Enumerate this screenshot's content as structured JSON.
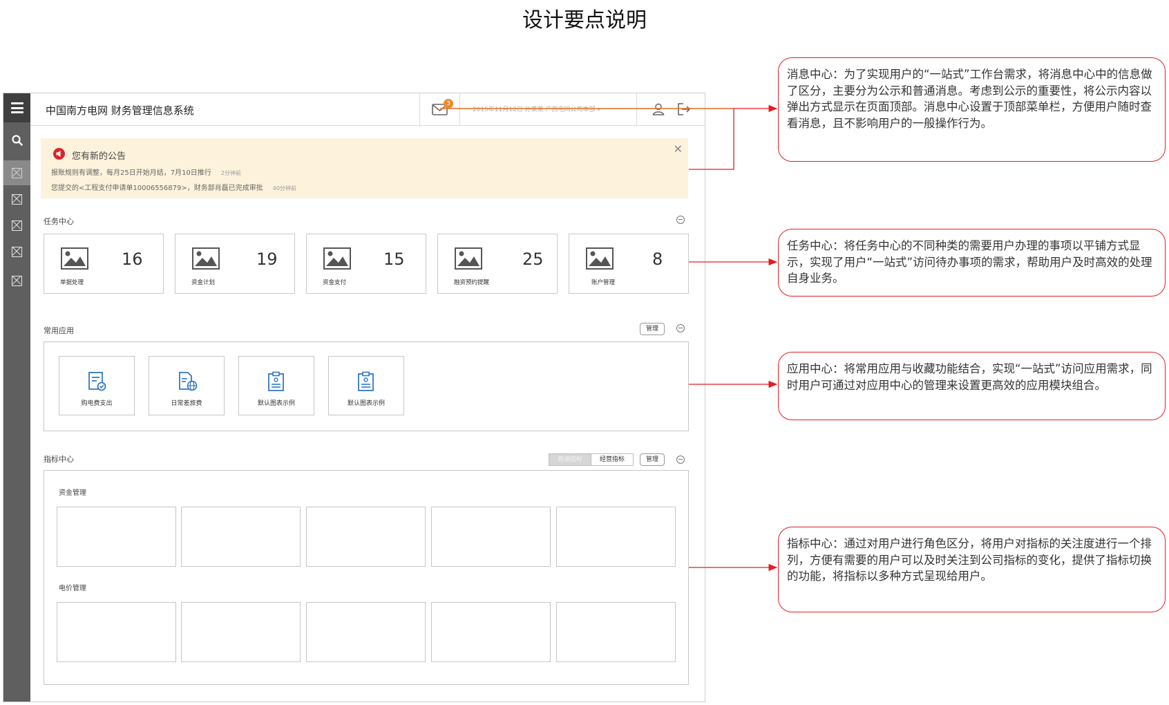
{
  "page": {
    "title": "设计要点说明"
  },
  "app": {
    "title": "中国南方电网 财务管理信息系统",
    "mail_badge": "3",
    "user_info": "2015年11月12日 孙某某 广西电网公司本部 ▾",
    "icons": [
      "menu-icon",
      "search-icon",
      "mail-icon",
      "user-icon",
      "logout-icon"
    ]
  },
  "notice": {
    "title": "您有新的公告",
    "items": [
      {
        "text": "报账规则有调整，每月25日开始月结，7月10日推行",
        "time": "2分钟前"
      },
      {
        "text": "您提交的<工程支付申请单10006556879>，财务部肖磊已完成审批",
        "time": "40分钟前"
      }
    ]
  },
  "task_center": {
    "label": "任务中心",
    "cards": [
      {
        "label": "单据处理",
        "count": "16"
      },
      {
        "label": "资金计划",
        "count": "19"
      },
      {
        "label": "资金支付",
        "count": "15"
      },
      {
        "label": "融资预约提醒",
        "count": "25"
      },
      {
        "label": "账户管理",
        "count": "8"
      }
    ]
  },
  "common_apps": {
    "label": "常用应用",
    "manage": "管理",
    "apps": [
      {
        "label": "购电费支出",
        "icon": "form-check-icon"
      },
      {
        "label": "日常差旅费",
        "icon": "document-globe-icon"
      },
      {
        "label": "默认图表示例",
        "icon": "clipboard-icon"
      },
      {
        "label": "默认图表示例",
        "icon": "clipboard-icon"
      }
    ]
  },
  "metrics": {
    "label": "指标中心",
    "tabs": [
      "普通指标",
      "经营指标"
    ],
    "active_tab": "普通指标",
    "manage": "管理",
    "groups": [
      "资金管理",
      "电价管理"
    ]
  },
  "annotations": [
    {
      "text": "消息中心：为了实现用户的“一站式”工作台需求，将消息中心中的信息做了区分，主要分为公示和普通消息。考虑到公示的重要性，将公示内容以弹出方式显示在页面顶部。消息中心设置于顶部菜单栏，方便用户随时查看消息，且不影响用户的一般操作行为。"
    },
    {
      "text": "任务中心：将任务中心的不同种类的需要用户办理的事项以平铺方式显示，实现了用户“一站式”访问待办事项的需求，帮助用户及时高效的处理自身业务。"
    },
    {
      "text": "应用中心：将常用应用与收藏功能结合，实现“一站式”访问应用需求，同时用户可通过对应用中心的管理来设置更高效的应用模块组合。"
    },
    {
      "text": "指标中心：通过对用户进行角色区分，将用户对指标的关注度进行一个排列，方便有需要的用户可以及时关注到公司指标的变化，提供了指标切换的功能，将指标以多种方式呈现给用户。"
    }
  ],
  "colors": {
    "accent_red": "#e51c23",
    "badge_orange": "#f08a24",
    "notice_bg": "#fdf2dc",
    "sidebar": "#5f5f5f"
  }
}
